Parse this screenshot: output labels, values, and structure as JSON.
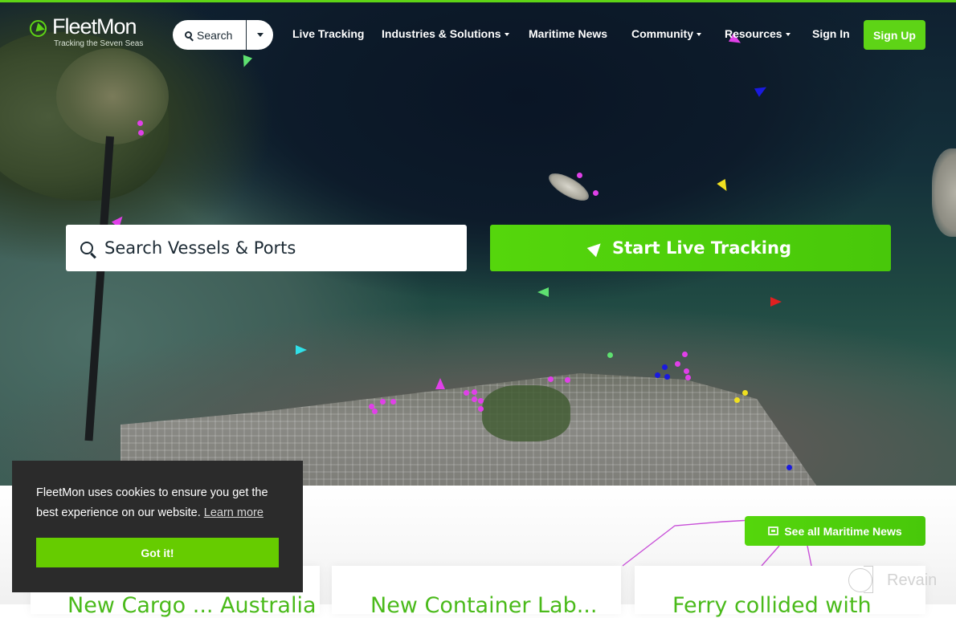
{
  "brand": {
    "name": "FleetMon",
    "tagline": "Tracking the Seven Seas",
    "accent_color": "#5ed416"
  },
  "navbar": {
    "search_label": "Search",
    "links": [
      {
        "label": "Live Tracking",
        "has_dropdown": false
      },
      {
        "label": "Industries & Solutions",
        "has_dropdown": true
      },
      {
        "label": "Maritime News",
        "has_dropdown": false
      },
      {
        "label": "Community",
        "has_dropdown": true
      },
      {
        "label": "Resources",
        "has_dropdown": true
      }
    ],
    "sign_in": "Sign In",
    "sign_up": "Sign Up"
  },
  "hero": {
    "search_placeholder": "Search Vessels & Ports",
    "live_tracking_button": "Start Live Tracking",
    "map_vessel_colors": {
      "magenta": "#e040e8",
      "blue": "#1a1adf",
      "yellow": "#f0e020",
      "green": "#5ee070",
      "red": "#e02020",
      "cyan": "#30e0e8"
    }
  },
  "news": {
    "see_all_button": "See all Maritime News",
    "cards": [
      {
        "title": "New Cargo ... Australia"
      },
      {
        "title": "New Container Lab..."
      },
      {
        "title": "Ferry collided with"
      }
    ]
  },
  "cookie_banner": {
    "message": "FleetMon uses cookies to ensure you get the best experience on our website.",
    "learn_more": "Learn more",
    "accept_button": "Got it!"
  },
  "watermark": {
    "text": "Revain"
  }
}
